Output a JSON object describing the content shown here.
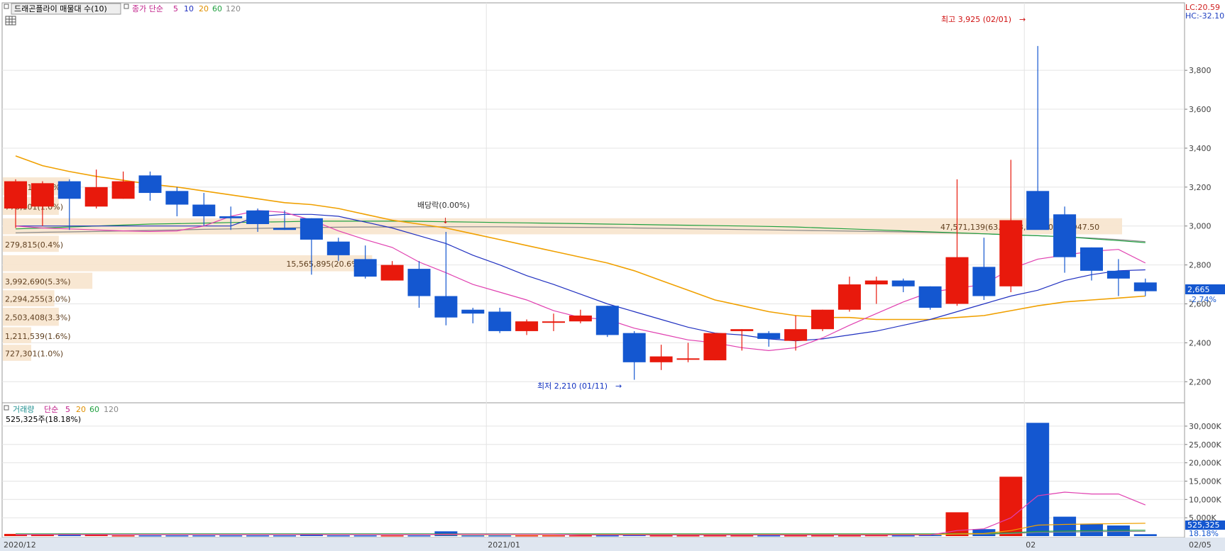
{
  "chart_data": [
    {
      "type": "candlestick",
      "legend": {
        "title": "드래곤플라이 매물대 수(10)",
        "ma_prefix": "종가 단순",
        "ma_periods": [
          "5",
          "10",
          "20",
          "60",
          "120"
        ],
        "ma_colors": [
          "#e040b0",
          "#2030c0",
          "#f0a000",
          "#20a040",
          "#888888"
        ]
      },
      "ylim": [
        2150,
        3950
      ],
      "yticks": [
        "2,200",
        "2,400",
        "2,600",
        "2,800",
        "3,000",
        "3,200",
        "3,400",
        "3,600",
        "3,800"
      ],
      "ytick_values": [
        2200,
        2400,
        2600,
        2800,
        3000,
        3200,
        3400,
        3600,
        3800
      ],
      "corner": {
        "lc": "LC:20.59",
        "hc": "HC:-32.10"
      },
      "last_price": {
        "value": 2665,
        "label": "2,665",
        "change": "-2.74%"
      },
      "candles": [
        {
          "o": 3090,
          "h": 3240,
          "l": 2990,
          "c": 3230
        },
        {
          "o": 3100,
          "h": 3230,
          "l": 3000,
          "c": 3220
        },
        {
          "o": 3230,
          "h": 3240,
          "l": 2980,
          "c": 3140
        },
        {
          "o": 3100,
          "h": 3290,
          "l": 3090,
          "c": 3200
        },
        {
          "o": 3140,
          "h": 3280,
          "l": 3140,
          "c": 3230
        },
        {
          "o": 3260,
          "h": 3280,
          "l": 3130,
          "c": 3170
        },
        {
          "o": 3180,
          "h": 3200,
          "l": 3050,
          "c": 3110
        },
        {
          "o": 3110,
          "h": 3170,
          "l": 3000,
          "c": 3050
        },
        {
          "o": 3050,
          "h": 3100,
          "l": 2980,
          "c": 3040
        },
        {
          "o": 3080,
          "h": 3090,
          "l": 2970,
          "c": 3010
        },
        {
          "o": 2990,
          "h": 3080,
          "l": 2980,
          "c": 2980
        },
        {
          "o": 3040,
          "h": 3040,
          "l": 2750,
          "c": 2930
        },
        {
          "o": 2920,
          "h": 2940,
          "l": 2820,
          "c": 2850
        },
        {
          "o": 2830,
          "h": 2900,
          "l": 2730,
          "c": 2740
        },
        {
          "o": 2720,
          "h": 2820,
          "l": 2720,
          "c": 2800
        },
        {
          "o": 2780,
          "h": 2820,
          "l": 2580,
          "c": 2640
        },
        {
          "o": 2640,
          "h": 2970,
          "l": 2490,
          "c": 2530
        },
        {
          "o": 2570,
          "h": 2580,
          "l": 2500,
          "c": 2550
        },
        {
          "o": 2560,
          "h": 2580,
          "l": 2450,
          "c": 2460
        },
        {
          "o": 2460,
          "h": 2520,
          "l": 2440,
          "c": 2510
        },
        {
          "o": 2510,
          "h": 2550,
          "l": 2460,
          "c": 2510
        },
        {
          "o": 2510,
          "h": 2570,
          "l": 2500,
          "c": 2540
        },
        {
          "o": 2590,
          "h": 2590,
          "l": 2430,
          "c": 2440
        },
        {
          "o": 2450,
          "h": 2460,
          "l": 2210,
          "c": 2300
        },
        {
          "o": 2300,
          "h": 2390,
          "l": 2260,
          "c": 2330
        },
        {
          "o": 2320,
          "h": 2400,
          "l": 2300,
          "c": 2320
        },
        {
          "o": 2310,
          "h": 2450,
          "l": 2310,
          "c": 2450
        },
        {
          "o": 2460,
          "h": 2470,
          "l": 2360,
          "c": 2470
        },
        {
          "o": 2450,
          "h": 2460,
          "l": 2380,
          "c": 2420
        },
        {
          "o": 2410,
          "h": 2540,
          "l": 2360,
          "c": 2470
        },
        {
          "o": 2470,
          "h": 2570,
          "l": 2460,
          "c": 2570
        },
        {
          "o": 2570,
          "h": 2740,
          "l": 2560,
          "c": 2700
        },
        {
          "o": 2700,
          "h": 2740,
          "l": 2600,
          "c": 2720
        },
        {
          "o": 2720,
          "h": 2730,
          "l": 2660,
          "c": 2690
        },
        {
          "o": 2690,
          "h": 2690,
          "l": 2570,
          "c": 2580
        },
        {
          "o": 2600,
          "h": 3240,
          "l": 2590,
          "c": 2840
        },
        {
          "o": 2790,
          "h": 2940,
          "l": 2620,
          "c": 2640
        },
        {
          "o": 2690,
          "h": 3340,
          "l": 2660,
          "c": 3030
        },
        {
          "o": 3180,
          "h": 3925,
          "l": 2990,
          "c": 2980
        },
        {
          "o": 3060,
          "h": 3100,
          "l": 2760,
          "c": 2840
        },
        {
          "o": 2890,
          "h": 2890,
          "l": 2720,
          "c": 2770
        },
        {
          "o": 2770,
          "h": 2830,
          "l": 2640,
          "c": 2730
        },
        {
          "o": 2710,
          "h": 2730,
          "l": 2640,
          "c": 2665
        }
      ],
      "ma5": [
        3000,
        2990,
        2985,
        2980,
        2975,
        2972,
        2975,
        3000,
        3050,
        3080,
        3070,
        3030,
        2975,
        2930,
        2890,
        2815,
        2760,
        2700,
        2660,
        2620,
        2565,
        2530,
        2520,
        2475,
        2445,
        2415,
        2400,
        2375,
        2360,
        2375,
        2425,
        2490,
        2550,
        2610,
        2660,
        2680,
        2700,
        2780,
        2830,
        2850,
        2870,
        2880,
        2810
      ],
      "ma10": [
        3000,
        3000,
        3000,
        3000,
        3000,
        3000,
        3000,
        3000,
        3000,
        3050,
        3060,
        3060,
        3050,
        3020,
        2990,
        2950,
        2910,
        2850,
        2800,
        2745,
        2700,
        2650,
        2600,
        2560,
        2520,
        2480,
        2450,
        2440,
        2420,
        2410,
        2420,
        2440,
        2460,
        2490,
        2520,
        2560,
        2600,
        2640,
        2670,
        2720,
        2750,
        2770,
        2775
      ],
      "ma20": [
        3360,
        3310,
        3280,
        3255,
        3235,
        3215,
        3200,
        3180,
        3160,
        3140,
        3120,
        3110,
        3090,
        3060,
        3030,
        3010,
        2990,
        2960,
        2930,
        2900,
        2870,
        2840,
        2810,
        2770,
        2720,
        2670,
        2620,
        2590,
        2560,
        2540,
        2530,
        2530,
        2520,
        2520,
        2520,
        2530,
        2540,
        2565,
        2590,
        2610,
        2620,
        2630,
        2640
      ],
      "ma60": [
        2985,
        2990,
        2995,
        3000,
        3005,
        3010,
        3012,
        3015,
        3018,
        3020,
        3022,
        3025,
        3025,
        3025,
        3025,
        3024,
        3022,
        3020,
        3018,
        3016,
        3014,
        3012,
        3010,
        3008,
        3006,
        3004,
        3002,
        3000,
        2998,
        2995,
        2990,
        2985,
        2980,
        2975,
        2970,
        2965,
        2960,
        2955,
        2950,
        2945,
        2935,
        2925,
        2915
      ],
      "ma120": [
        2965,
        2968,
        2970,
        2972,
        2975,
        2978,
        2980,
        2983,
        2985,
        2988,
        2990,
        2992,
        2994,
        2995,
        2995,
        2996,
        2996,
        2996,
        2996,
        2995,
        2994,
        2993,
        2992,
        2990,
        2988,
        2986,
        2984,
        2982,
        2980,
        2978,
        2976,
        2974,
        2972,
        2970,
        2967,
        2964,
        2960,
        2955,
        2950,
        2945,
        2938,
        2930,
        2920
      ],
      "price_bands": [
        {
          "label": "624,917(0.6%)",
          "low": 3150,
          "high": 3250,
          "weight": 0.06
        },
        {
          "label": "778,101(1.0%)",
          "low": 3050,
          "high": 3150,
          "weight": 0.05
        },
        {
          "label": "47,571,139(63.0%) 3,040.00 ~ 2,947.50",
          "low": 2950,
          "high": 3040,
          "weight": 1.0
        },
        {
          "label": "279,815(0.4%)",
          "low": 2860,
          "high": 2950,
          "weight": 0.05
        },
        {
          "label": "15,565,895(20.6%)",
          "low": 2760,
          "high": 2850,
          "weight": 0.33
        },
        {
          "label": "3,992,690(5.3%)",
          "low": 2670,
          "high": 2760,
          "weight": 0.08
        },
        {
          "label": "2,294,255(3.0%)",
          "low": 2580,
          "high": 2670,
          "weight": 0.046
        },
        {
          "label": "2,503,408(3.3%)",
          "low": 2480,
          "high": 2580,
          "weight": 0.05
        },
        {
          "label": "1,211,539(1.6%)",
          "low": 2390,
          "high": 2480,
          "weight": 0.025
        },
        {
          "label": "727,301(1.0%)",
          "low": 2300,
          "high": 2390,
          "weight": 0.015
        }
      ],
      "annotations": {
        "high": "최고 3,925 (02/01)",
        "low": "최저 2,210 (01/11)",
        "dividend": "배당락(0.00%)"
      }
    },
    {
      "type": "bar",
      "legend": {
        "title": "거래량",
        "ma_prefix": "단순",
        "ma_periods": [
          "5",
          "20",
          "60",
          "120"
        ],
        "ma_colors": [
          "#e040b0",
          "#f0a000",
          "#20a040",
          "#888888"
        ]
      },
      "info": "525,325주(18.18%)",
      "ylim": [
        0,
        32500
      ],
      "yticks": [
        "5,000K",
        "10,000K",
        "15,000K",
        "20,000K",
        "25,000K",
        "30,000K"
      ],
      "ytick_values": [
        5000,
        10000,
        15000,
        20000,
        25000,
        30000
      ],
      "last": {
        "label": "525,325",
        "pct": "18.18%"
      },
      "volumes": [
        600,
        300,
        700,
        300,
        200,
        200,
        200,
        200,
        200,
        200,
        200,
        300,
        200,
        200,
        200,
        200,
        1300,
        200,
        200,
        200,
        200,
        200,
        200,
        300,
        200,
        200,
        200,
        200,
        200,
        200,
        200,
        200,
        250,
        200,
        300,
        6500,
        1900,
        16200,
        30900,
        5300,
        3400,
        2900,
        525
      ],
      "ma5": [
        400,
        400,
        400,
        400,
        400,
        400,
        400,
        400,
        400,
        400,
        400,
        400,
        400,
        400,
        400,
        400,
        500,
        500,
        500,
        500,
        500,
        300,
        300,
        300,
        300,
        300,
        300,
        300,
        300,
        300,
        300,
        300,
        300,
        300,
        300,
        1500,
        2000,
        5000,
        11000,
        12000,
        11500,
        11500,
        8500
      ],
      "ma20": [
        400,
        400,
        400,
        400,
        400,
        400,
        400,
        400,
        400,
        400,
        400,
        400,
        400,
        400,
        400,
        400,
        400,
        400,
        400,
        400,
        400,
        400,
        400,
        400,
        400,
        400,
        400,
        400,
        400,
        400,
        400,
        400,
        400,
        400,
        400,
        600,
        700,
        1500,
        3000,
        3200,
        3300,
        3400,
        3500
      ],
      "ma60": [
        600,
        600,
        600,
        600,
        600,
        600,
        600,
        600,
        600,
        600,
        600,
        600,
        600,
        600,
        600,
        600,
        600,
        600,
        600,
        600,
        600,
        600,
        600,
        600,
        600,
        600,
        600,
        600,
        600,
        600,
        600,
        600,
        600,
        600,
        600,
        700,
        700,
        900,
        1300,
        1400,
        1500,
        1600,
        1600
      ],
      "ma120": [
        500,
        500,
        500,
        500,
        500,
        500,
        500,
        500,
        500,
        500,
        500,
        500,
        500,
        500,
        500,
        500,
        500,
        500,
        500,
        500,
        500,
        500,
        500,
        500,
        500,
        500,
        500,
        500,
        500,
        500,
        500,
        500,
        500,
        500,
        500,
        550,
        550,
        700,
        1000,
        1100,
        1200,
        1250,
        1300
      ]
    }
  ],
  "x_axis": {
    "labels": [
      {
        "index": 0,
        "text": "2020/12"
      },
      {
        "index": 18,
        "text": "2021/01"
      },
      {
        "index": 38,
        "text": "02"
      },
      {
        "index": 44,
        "text": "02/05"
      }
    ]
  },
  "colors": {
    "up": "#e8190c",
    "down": "#1457d0",
    "band": "#f8e6d0",
    "band_text": "#604020",
    "grid": "#e4e4e4",
    "axis_text": "#404040"
  }
}
